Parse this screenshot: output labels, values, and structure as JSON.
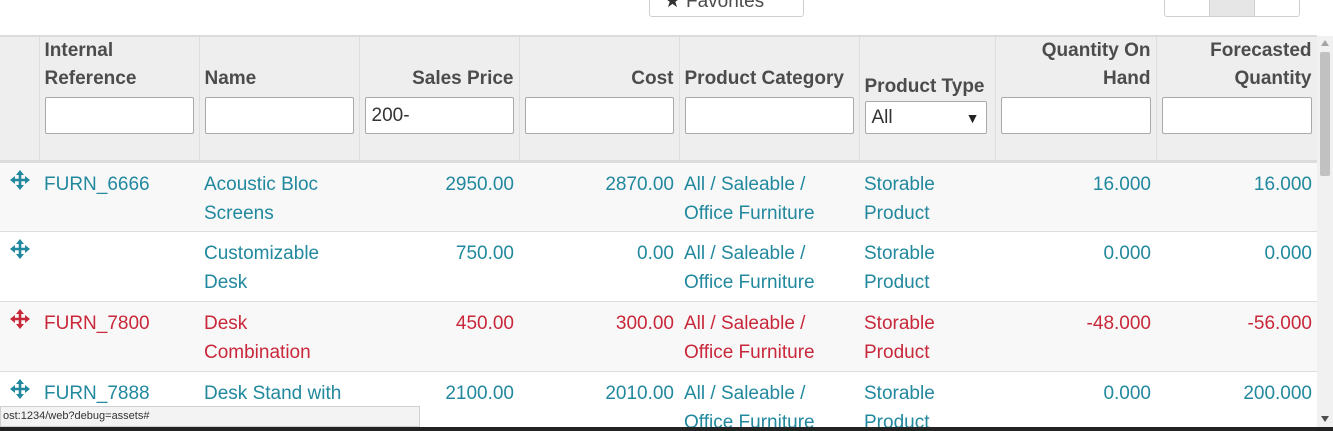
{
  "toolbar": {
    "favorites_label": "Favorites"
  },
  "table": {
    "headers": {
      "internal_reference": "Internal Reference",
      "name": "Name",
      "sales_price": "Sales Price",
      "cost": "Cost",
      "product_category": "Product Category",
      "product_type": "Product Type",
      "quantity_on_hand": "Quantity On Hand",
      "forecasted_quantity": "Forecasted Quantity"
    },
    "filters": {
      "internal_reference": "",
      "name": "",
      "sales_price": "200-",
      "cost": "",
      "product_category": "",
      "product_type": "All",
      "quantity_on_hand": "",
      "forecasted_quantity": ""
    },
    "rows": [
      {
        "ref": "FURN_6666",
        "name": "Acoustic Bloc Screens",
        "sales_price": "2950.00",
        "cost": "2870.00",
        "category": "All / Saleable / Office Furniture",
        "type": "Storable Product",
        "on_hand": "16.000",
        "forecast": "16.000",
        "status": "normal"
      },
      {
        "ref": "",
        "name": "Customizable Desk",
        "sales_price": "750.00",
        "cost": "0.00",
        "category": "All / Saleable / Office Furniture",
        "type": "Storable Product",
        "on_hand": "0.000",
        "forecast": "0.000",
        "status": "normal"
      },
      {
        "ref": "FURN_7800",
        "name": "Desk Combination",
        "sales_price": "450.00",
        "cost": "300.00",
        "category": "All / Saleable / Office Furniture",
        "type": "Storable Product",
        "on_hand": "-48.000",
        "forecast": "-56.000",
        "status": "negative"
      },
      {
        "ref": "FURN_7888",
        "name": "Desk Stand with Screen",
        "sales_price": "2100.00",
        "cost": "2010.00",
        "category": "All / Saleable / Office Furniture",
        "type": "Storable Product",
        "on_hand": "0.000",
        "forecast": "200.000",
        "status": "normal"
      }
    ]
  },
  "colors": {
    "link_teal": "#21889e",
    "negative_red": "#c8283a",
    "header_bg": "#eeeeee"
  },
  "status_bar": {
    "url": "ost:1234/web?debug=assets#"
  }
}
